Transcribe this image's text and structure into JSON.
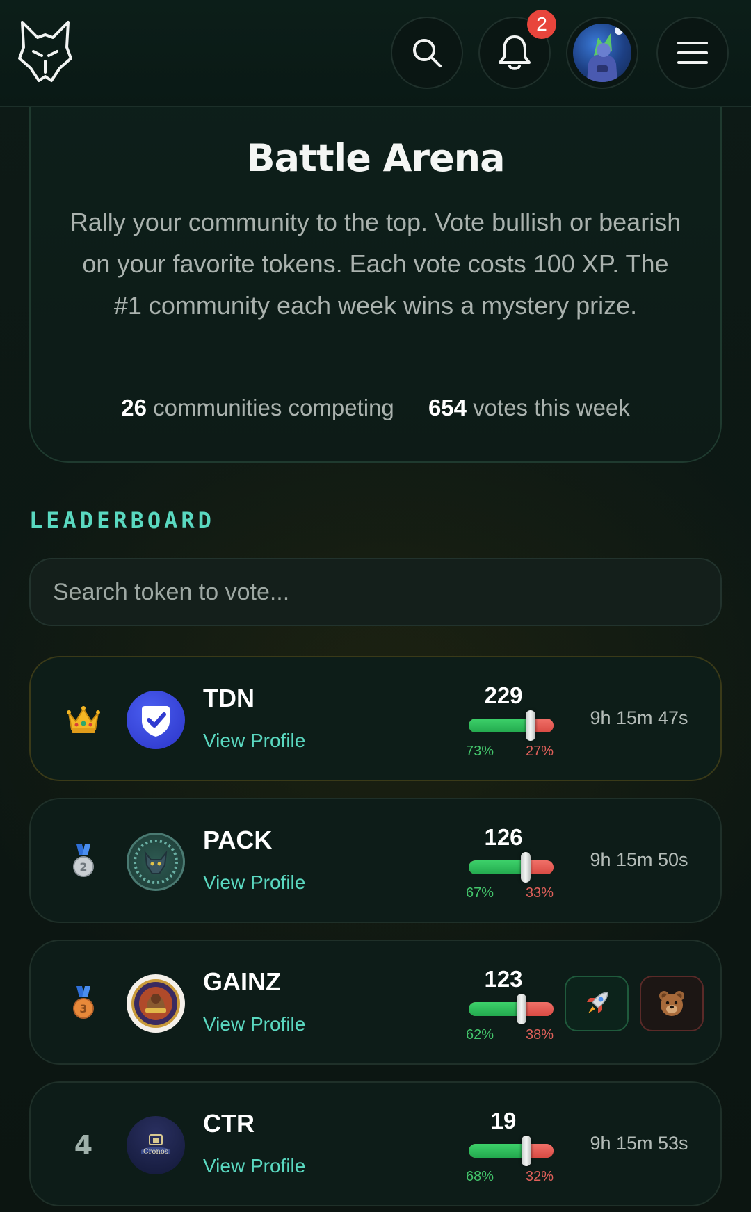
{
  "header": {
    "logo": "wolf-logo",
    "notification_count": "2",
    "icons": [
      "search-icon",
      "bell-icon",
      "avatar",
      "hamburger-menu-icon"
    ]
  },
  "hero": {
    "title": "Battle Arena",
    "description": "Rally your community to the top. Vote bullish or bearish on your favorite tokens. Each vote costs 100 XP. The #1 community each week wins a mystery prize.",
    "stats": [
      {
        "value": "26",
        "label": "communities competing"
      },
      {
        "value": "654",
        "label": "votes this week"
      }
    ]
  },
  "leaderboard": {
    "title": "LEADERBOARD",
    "search_placeholder": "Search token to vote...",
    "view_profile_label": "View Profile",
    "rows": [
      {
        "rank": "1",
        "rank_icon": "crown-icon",
        "name": "TDN",
        "logo": "shield-check-logo",
        "votes": "229",
        "bull_pct": "73%",
        "bear_pct": "27%",
        "bull_fraction": 0.73,
        "timer": "9h 15m 47s"
      },
      {
        "rank": "2",
        "rank_icon": "silver-medal-icon",
        "name": "PACK",
        "logo": "wolf-coin-logo",
        "votes": "126",
        "bull_pct": "67%",
        "bear_pct": "33%",
        "bull_fraction": 0.67,
        "timer": "9h 15m 50s"
      },
      {
        "rank": "3",
        "rank_icon": "bronze-medal-icon",
        "name": "GAINZ",
        "logo": "gainz-coin-logo",
        "votes": "123",
        "bull_pct": "62%",
        "bear_pct": "38%",
        "bull_fraction": 0.62,
        "vote_buttons": [
          "rocket-icon",
          "bear-icon"
        ]
      },
      {
        "rank": "4",
        "rank_icon": "",
        "name": "CTR",
        "logo": "cronos-treasury-logo",
        "votes": "19",
        "bull_pct": "68%",
        "bear_pct": "32%",
        "bull_fraction": 0.68,
        "timer": "9h 15m 53s"
      }
    ]
  },
  "colors": {
    "accent": "#5ad8c0",
    "bull": "#3dd16a",
    "bear": "#e0504a",
    "badge": "#e8453c",
    "background": "#0c1511"
  }
}
